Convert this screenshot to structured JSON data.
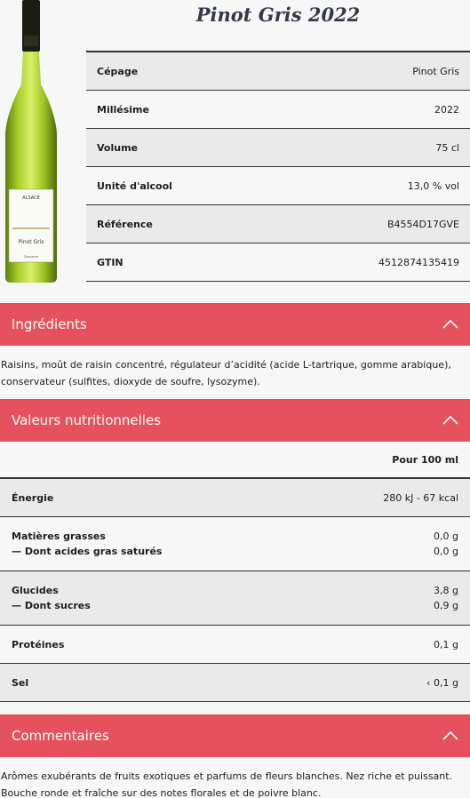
{
  "product": {
    "title": "Pinot Gris 2022",
    "bottle_label_region": "ALSACE",
    "bottle_label_name": "Pinot Gris",
    "bottle_label_producer": "Domaine",
    "specs": [
      {
        "label": "Cépage",
        "value": "Pinot Gris"
      },
      {
        "label": "Millésime",
        "value": "2022"
      },
      {
        "label": "Volume",
        "value": "75 cl"
      },
      {
        "label": "Unité d'alcool",
        "value": "13,0 % vol"
      },
      {
        "label": "Référence",
        "value": "B4554D17GVE"
      },
      {
        "label": "GTIN",
        "value": "4512874135419"
      }
    ]
  },
  "ingredients": {
    "title": "Ingrédients",
    "text": "Raisins, moût de raisin concentré, régulateur d’acidité (acide L-tartrique, gomme arabique), conservateur (sulfites, dioxyde de soufre, lysozyme)."
  },
  "nutrition": {
    "title": "Valeurs nutritionnelles",
    "per": "Pour 100 ml",
    "energy": {
      "label": "Énergie",
      "value": "280 kJ - 67 kcal"
    },
    "fat": {
      "label": "Matières grasses",
      "value": "0,0 g",
      "sub_label": "— Dont acides gras saturés",
      "sub_value": "0,0 g"
    },
    "carbs": {
      "label": "Glucides",
      "value": "3,8 g",
      "sub_label": "— Dont sucres",
      "sub_value": "0,9 g"
    },
    "protein": {
      "label": "Protéines",
      "value": "0,1 g"
    },
    "salt": {
      "label": "Sel",
      "value": "‹ 0,1 g"
    }
  },
  "comments": {
    "title": "Commentaires",
    "text": "Arômes exubérants de fruits exotiques et parfums de fleurs blanches. Nez riche et puissant. Bouche ronde et fraîche sur des notes florales et de poivre blanc."
  },
  "colors": {
    "accent": "#e5525d",
    "title": "#333a44",
    "row_alt": "#eaeaea",
    "background": "#f7f7f7"
  }
}
